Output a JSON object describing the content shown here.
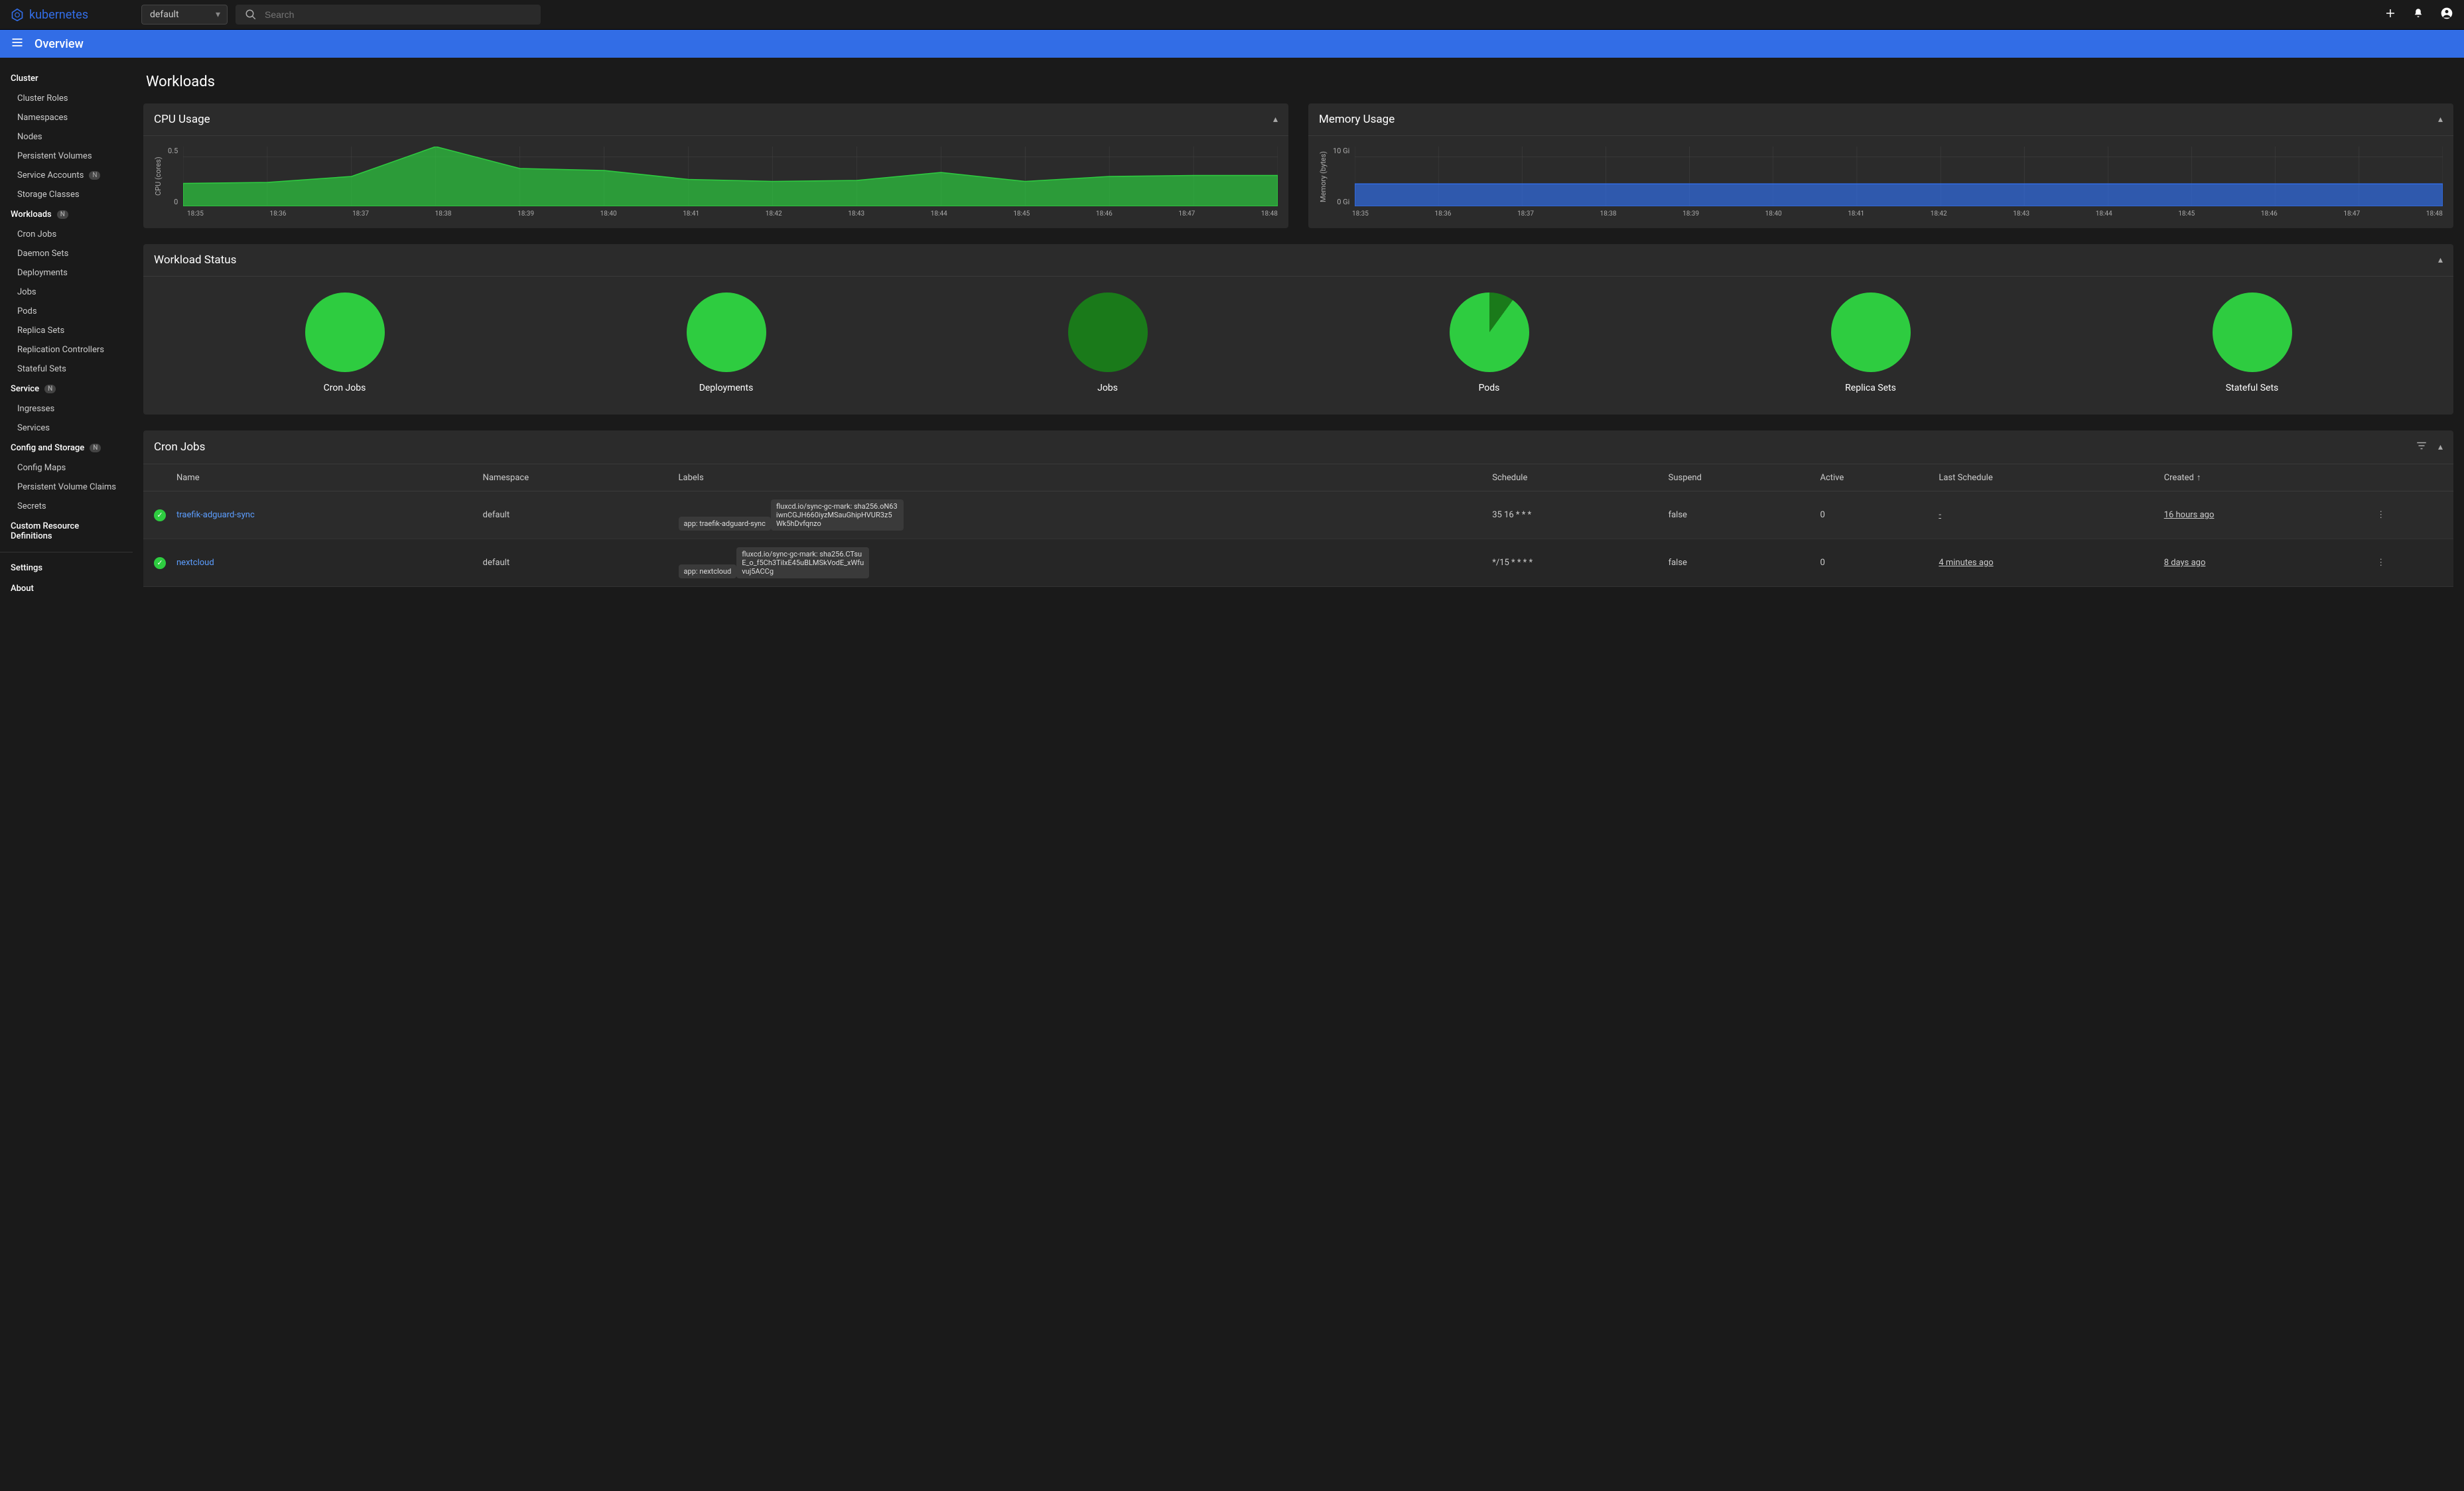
{
  "brand": "kubernetes",
  "namespace_selected": "default",
  "search_placeholder": "Search",
  "bluebar_title": "Overview",
  "sidebar": {
    "cluster": {
      "heading": "Cluster",
      "items": [
        "Cluster Roles",
        "Namespaces",
        "Nodes",
        "Persistent Volumes",
        "Service Accounts",
        "Storage Classes"
      ],
      "badged": [
        4
      ]
    },
    "workloads": {
      "heading": "Workloads",
      "items": [
        "Cron Jobs",
        "Daemon Sets",
        "Deployments",
        "Jobs",
        "Pods",
        "Replica Sets",
        "Replication Controllers",
        "Stateful Sets"
      ]
    },
    "service": {
      "heading": "Service",
      "items": [
        "Ingresses",
        "Services"
      ]
    },
    "config": {
      "heading": "Config and Storage",
      "items": [
        "Config Maps",
        "Persistent Volume Claims",
        "Secrets"
      ]
    },
    "crd": {
      "heading": "Custom Resource Definitions"
    },
    "settings": "Settings",
    "about": "About"
  },
  "page_title": "Workloads",
  "charts": {
    "cpu": {
      "title": "CPU Usage",
      "ylabel": "CPU (cores)",
      "y_ticks": [
        "0.5",
        "0"
      ]
    },
    "mem": {
      "title": "Memory Usage",
      "ylabel": "Memory (bytes)",
      "y_ticks": [
        "10 Gi",
        "0 Gi"
      ]
    },
    "x_ticks": [
      "18:35",
      "18:36",
      "18:37",
      "18:38",
      "18:39",
      "18:40",
      "18:41",
      "18:42",
      "18:43",
      "18:44",
      "18:45",
      "18:46",
      "18:47",
      "18:48"
    ]
  },
  "chart_data": [
    {
      "type": "area",
      "title": "CPU Usage",
      "ylabel": "CPU (cores)",
      "ylim": [
        0,
        0.6
      ],
      "x": [
        "18:35",
        "18:36",
        "18:37",
        "18:38",
        "18:39",
        "18:40",
        "18:41",
        "18:42",
        "18:43",
        "18:44",
        "18:45",
        "18:46",
        "18:47",
        "18:48"
      ],
      "values": [
        0.23,
        0.24,
        0.3,
        0.6,
        0.38,
        0.36,
        0.27,
        0.25,
        0.26,
        0.34,
        0.25,
        0.3,
        0.31,
        0.31
      ]
    },
    {
      "type": "area",
      "title": "Memory Usage",
      "ylabel": "Memory (bytes)",
      "ylim": [
        0,
        12
      ],
      "yunit": "Gi",
      "x": [
        "18:35",
        "18:36",
        "18:37",
        "18:38",
        "18:39",
        "18:40",
        "18:41",
        "18:42",
        "18:43",
        "18:44",
        "18:45",
        "18:46",
        "18:47",
        "18:48"
      ],
      "values": [
        4.5,
        4.5,
        4.5,
        4.5,
        4.5,
        4.5,
        4.5,
        4.5,
        4.5,
        4.5,
        4.5,
        4.5,
        4.5,
        4.5
      ]
    }
  ],
  "workload_status": {
    "title": "Workload Status",
    "items": [
      {
        "label": "Cron Jobs",
        "running_pct": 100
      },
      {
        "label": "Deployments",
        "running_pct": 100
      },
      {
        "label": "Jobs",
        "running_pct": 0
      },
      {
        "label": "Pods",
        "running_pct": 90
      },
      {
        "label": "Replica Sets",
        "running_pct": 100
      },
      {
        "label": "Stateful Sets",
        "running_pct": 100
      }
    ]
  },
  "cron_jobs": {
    "title": "Cron Jobs",
    "columns": [
      "Name",
      "Namespace",
      "Labels",
      "Schedule",
      "Suspend",
      "Active",
      "Last Schedule",
      "Created"
    ],
    "sort_col": "Created",
    "sort_dir": "asc",
    "rows": [
      {
        "status": "ok",
        "name": "traefik-adguard-sync",
        "namespace": "default",
        "labels": [
          "app: traefik-adguard-sync",
          "fluxcd.io/sync-gc-mark: sha256.oN63iwnCGJH660iyzMSauGhipHVUR3z5Wk5hDvfqnzo"
        ],
        "schedule": "35 16 * * *",
        "suspend": "false",
        "active": "0",
        "last_schedule": "-",
        "created": "16 hours ago"
      },
      {
        "status": "ok",
        "name": "nextcloud",
        "namespace": "default",
        "labels": [
          "app: nextcloud",
          "fluxcd.io/sync-gc-mark: sha256.CTsuE_o_f5Ch3TilxE45uBLMSkVodE_xWfuvuj5ACCg"
        ],
        "schedule": "*/15 * * * *",
        "suspend": "false",
        "active": "0",
        "last_schedule": "4 minutes ago",
        "created": "8 days ago"
      }
    ]
  }
}
